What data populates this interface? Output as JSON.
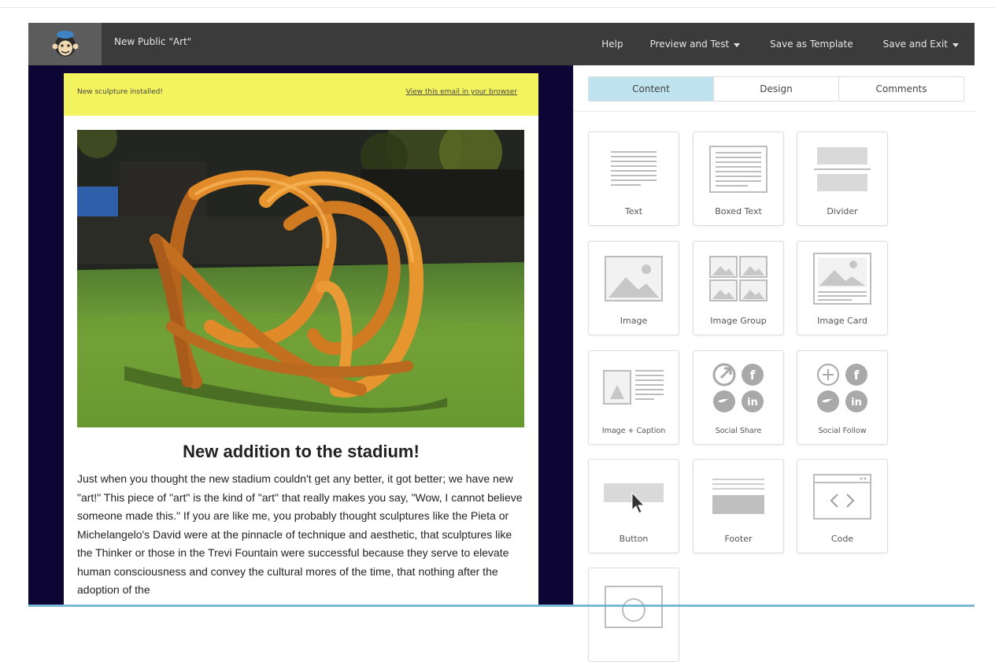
{
  "app": {
    "campaign_title": "New Public \"Art\"",
    "nav": {
      "help": "Help",
      "preview_and_test": "Preview and Test",
      "save_as_template": "Save as Template",
      "save_and_exit": "Save and Exit"
    }
  },
  "email": {
    "preheader_left": "New sculpture installed!",
    "preheader_right": "View this email in your browser",
    "headline": "New addition to the stadium!",
    "body": "Just when you thought the new stadium couldn't get any better, it got better; we have new \"art!\" This piece of \"art\" is the kind of \"art\" that really makes you say, \"Wow, I cannot believe someone made this.\" If you are like me, you probably thought sculptures like the Pieta or Michelangelo's David were at the pinnacle of technique and aesthetic, that sculptures like the Thinker or those in the Trevi Fountain were successful because they serve to elevate human consciousness and convey the cultural mores of the time, that nothing after the adoption of the"
  },
  "panel": {
    "tabs": [
      "Content",
      "Design",
      "Comments"
    ],
    "active_tab": "Content",
    "blocks": [
      "Text",
      "Boxed Text",
      "Divider",
      "Image",
      "Image Group",
      "Image Card",
      "Image + Caption",
      "Social Share",
      "Social Follow",
      "Button",
      "Footer",
      "Code"
    ]
  },
  "colors": {
    "topbar": "#3b3b3b",
    "canvas": "#0d0533",
    "preheader": "#f3f35e",
    "active_tab": "#bfe3ef"
  }
}
